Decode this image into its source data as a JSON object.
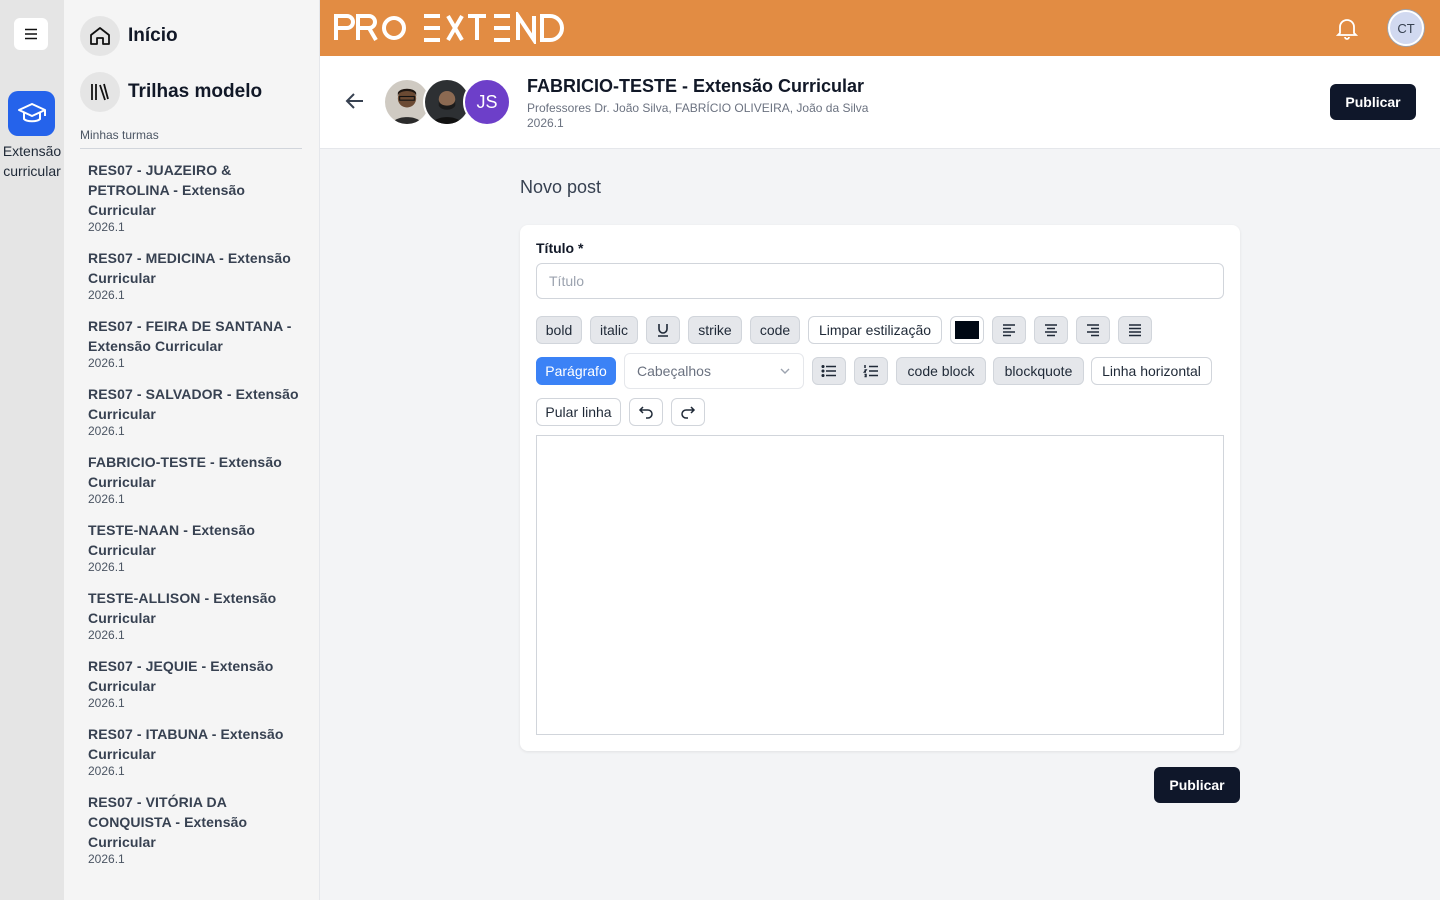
{
  "rail": {
    "menu_icon": "hamburger-icon",
    "app_icon": "graduation-cap-icon",
    "app_label": "Extensão curricular"
  },
  "sidebar": {
    "nav": [
      {
        "label": "Início",
        "icon": "home-icon"
      },
      {
        "label": "Trilhas modelo",
        "icon": "library-icon"
      }
    ],
    "section_label": "Minhas turmas",
    "classes": [
      {
        "name": "RES07 - JUAZEIRO & PETROLINA - Extensão Curricular",
        "term": "2026.1"
      },
      {
        "name": "RES07 - MEDICINA - Extensão Curricular",
        "term": "2026.1"
      },
      {
        "name": "RES07 - FEIRA DE SANTANA - Extensão Curricular",
        "term": "2026.1"
      },
      {
        "name": "RES07 - SALVADOR - Extensão Curricular",
        "term": "2026.1"
      },
      {
        "name": "FABRICIO-TESTE - Extensão Curricular",
        "term": "2026.1"
      },
      {
        "name": "TESTE-NAAN - Extensão Curricular",
        "term": "2026.1"
      },
      {
        "name": "TESTE-ALLISON - Extensão Curricular",
        "term": "2026.1"
      },
      {
        "name": "RES07 - JEQUIE - Extensão Curricular",
        "term": "2026.1"
      },
      {
        "name": "RES07 - ITABUNA - Extensão Curricular",
        "term": "2026.1"
      },
      {
        "name": "RES07 - VITÓRIA DA CONQUISTA - Extensão Curricular",
        "term": "2026.1"
      }
    ]
  },
  "topbar": {
    "brand": "PRO EXTEND",
    "brand_color": "#e28c43",
    "bell_icon": "bell-icon",
    "user_initials": "CT"
  },
  "course": {
    "title": "FABRICIO-TESTE - Extensão Curricular",
    "professors": "Professores Dr. João Silva, FABRÍCIO OLIVEIRA, João da Silva",
    "term": "2026.1",
    "avatar_initials": "JS",
    "publish_label": "Publicar"
  },
  "post": {
    "page_title": "Novo post",
    "title_label": "Título *",
    "title_placeholder": "Título",
    "toolbar": {
      "bold": "bold",
      "italic": "italic",
      "strike": "strike",
      "code": "code",
      "clear": "Limpar estilização",
      "text_color": "#000814",
      "paragraph": "Parágrafo",
      "headings": "Cabeçalhos",
      "code_block": "code block",
      "blockquote": "blockquote",
      "hr": "Linha horizontal",
      "hard_break": "Pular linha"
    },
    "publish_label": "Publicar"
  }
}
